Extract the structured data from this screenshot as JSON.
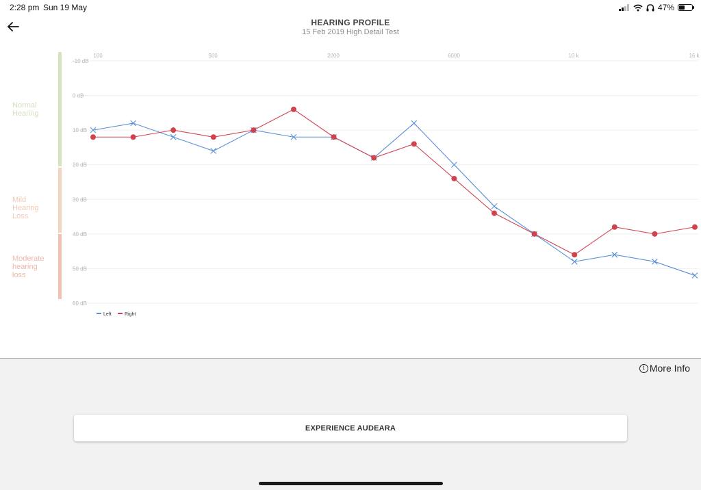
{
  "status_bar": {
    "time": "2:28 pm",
    "date": "Sun 19 May",
    "battery_percent": "47%",
    "battery_level": 0.47,
    "icons": [
      "signal-icon",
      "wifi-icon",
      "headphones-icon",
      "battery-icon"
    ]
  },
  "header": {
    "back_icon": "arrow-left-icon",
    "title": "HEARING PROFILE",
    "subtitle": "15 Feb 2019 High Detail Test"
  },
  "severity_bands": [
    {
      "label_lines": [
        "Normal",
        "Hearing"
      ],
      "color": "#d6e4c2",
      "text_color": "#d3e1c2",
      "range_db": [
        -10,
        20
      ]
    },
    {
      "label_lines": [
        "Mild",
        "Hearing",
        "Loss"
      ],
      "color": "#f2d5c3",
      "text_color": "#f0c9b4",
      "range_db": [
        20,
        40
      ]
    },
    {
      "label_lines": [
        "Moderate",
        "hearing",
        "loss"
      ],
      "color": "#f0c2b3",
      "text_color": "#eeb9a9",
      "range_db": [
        40,
        60
      ]
    }
  ],
  "chart_data": {
    "type": "line",
    "title": "",
    "x_tick_labels": [
      "100",
      "500",
      "2000",
      "6000",
      "10 k",
      "16 k"
    ],
    "y_tick_labels": [
      "-10 dB",
      "0 dB",
      "10 dB",
      "20 dB",
      "30 dB",
      "40 dB",
      "50 dB",
      "60 dB"
    ],
    "ylim": [
      -10,
      60
    ],
    "y_inverted": true,
    "grid": true,
    "legend_position": "bottom-left",
    "series": [
      {
        "name": "Left",
        "color": "#5a8fd8",
        "marker": "x",
        "values": [
          10,
          8,
          12,
          16,
          10,
          12,
          12,
          18,
          8,
          20,
          32,
          40,
          48,
          46,
          48,
          52
        ]
      },
      {
        "name": "Right",
        "color": "#d0434e",
        "marker": "circle",
        "values": [
          12,
          12,
          10,
          12,
          10,
          4,
          12,
          18,
          14,
          24,
          34,
          40,
          46,
          38,
          40,
          38
        ]
      }
    ]
  },
  "more_info": {
    "icon": "info-circle-icon",
    "label": "More Info"
  },
  "cta": {
    "label": "EXPERIENCE AUDEARA"
  }
}
